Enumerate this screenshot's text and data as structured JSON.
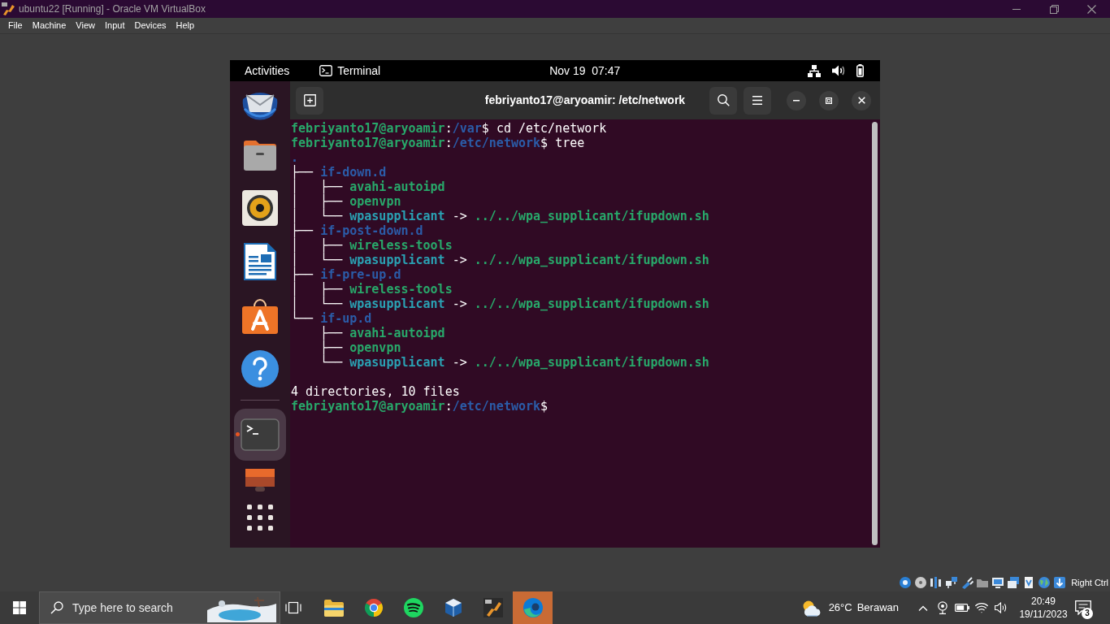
{
  "window": {
    "title": "ubuntu22 [Running] - Oracle VM VirtualBox"
  },
  "menu_bar": [
    "File",
    "Machine",
    "View",
    "Input",
    "Devices",
    "Help"
  ],
  "vm_screen": {
    "top_bar": {
      "activities": "Activities",
      "app_menu": "Terminal",
      "clock": "Nov 19  07:47"
    },
    "dock": {
      "pinned": [
        {
          "selected": false,
          "running": false
        },
        {
          "selected": false,
          "running": false
        },
        {
          "selected": false,
          "running": false
        },
        {
          "selected": false,
          "running": false
        },
        {
          "selected": false,
          "running": false
        },
        {
          "selected": false,
          "running": false
        }
      ],
      "others": [
        {
          "selected": true,
          "running": true
        },
        {
          "selected": false,
          "running": false
        }
      ]
    },
    "terminal": {
      "title": "febriyanto17@aryoamir: /etc/network",
      "lines": [
        {
          "kind": "prompt",
          "user": "febriyanto17@aryoamir",
          "separator": ":",
          "path": "/var",
          "symbol": "$",
          "command": "cd /etc/network"
        },
        {
          "kind": "prompt",
          "user": "febriyanto17@aryoamir",
          "separator": ":",
          "path": "/etc/network",
          "symbol": "$",
          "command": "tree"
        },
        {
          "kind": "tree",
          "root": ".",
          "entries": [
            {
              "prefix": "├──",
              "name": "if-down.d",
              "kind": "directory",
              "children": [
                {
                  "prefix": "│   ├──",
                  "name": "avahi-autoipd",
                  "kind": "executable"
                },
                {
                  "prefix": "│   ├──",
                  "name": "openvpn",
                  "kind": "executable"
                },
                {
                  "prefix": "│   └──",
                  "name": "wpasupplicant",
                  "kind": "symlink",
                  "arrow": "->",
                  "target": "../../wpa_supplicant/ifupdown.sh"
                }
              ]
            },
            {
              "prefix": "├──",
              "name": "if-post-down.d",
              "kind": "directory",
              "children": [
                {
                  "prefix": "│   ├──",
                  "name": "wireless-tools",
                  "kind": "executable"
                },
                {
                  "prefix": "│   └──",
                  "name": "wpasupplicant",
                  "kind": "symlink",
                  "arrow": "->",
                  "target": "../../wpa_supplicant/ifupdown.sh"
                }
              ]
            },
            {
              "prefix": "├──",
              "name": "if-pre-up.d",
              "kind": "directory",
              "children": [
                {
                  "prefix": "│   ├──",
                  "name": "wireless-tools",
                  "kind": "executable"
                },
                {
                  "prefix": "│   └──",
                  "name": "wpasupplicant",
                  "kind": "symlink",
                  "arrow": "->",
                  "target": "../../wpa_supplicant/ifupdown.sh"
                }
              ]
            },
            {
              "prefix": "└──",
              "name": "if-up.d",
              "kind": "directory",
              "children": [
                {
                  "prefix": "    ├──",
                  "name": "avahi-autoipd",
                  "kind": "executable"
                },
                {
                  "prefix": "    ├──",
                  "name": "openvpn",
                  "kind": "executable"
                },
                {
                  "prefix": "    └──",
                  "name": "wpasupplicant",
                  "kind": "symlink",
                  "arrow": "->",
                  "target": "../../wpa_supplicant/ifupdown.sh"
                }
              ]
            }
          ]
        },
        {
          "kind": "blank"
        },
        {
          "kind": "output",
          "text": "4 directories, 10 files"
        },
        {
          "kind": "prompt",
          "user": "febriyanto17@aryoamir",
          "separator": ":",
          "path": "/etc/network",
          "symbol": "$"
        }
      ]
    }
  },
  "status_bar": {
    "host_key": "Right Ctrl"
  },
  "taskbar": {
    "search": {
      "placeholder": "Type here to search"
    },
    "apps": [
      {
        "highlighted": false
      },
      {
        "highlighted": false
      },
      {
        "highlighted": false
      },
      {
        "highlighted": false
      },
      {
        "highlighted": false
      },
      {
        "highlighted": true
      }
    ],
    "weather": {
      "temperature": "26°C",
      "condition": "Berawan"
    },
    "clock": {
      "time": "20:49",
      "date": "19/11/2023"
    },
    "notifications": {
      "count": "3"
    }
  }
}
